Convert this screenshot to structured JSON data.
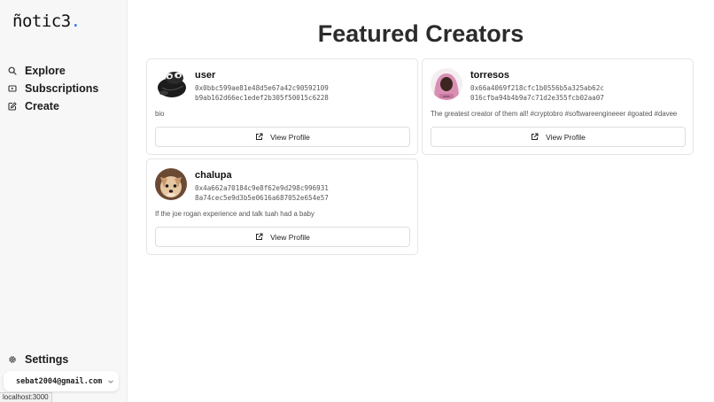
{
  "brand": {
    "name": "ñotic3",
    "dot": ".",
    "accent": "#2f6fe4"
  },
  "sidebar": {
    "items": [
      {
        "label": "Explore",
        "icon": "search-icon"
      },
      {
        "label": "Subscriptions",
        "icon": "subscriptions-icon"
      },
      {
        "label": "Create",
        "icon": "edit-icon"
      }
    ],
    "settings": {
      "label": "Settings",
      "icon": "gear-icon"
    },
    "account": {
      "email": "sebat2004@gmail.com",
      "icon": "chevron-down-icon"
    }
  },
  "status_bar": {
    "url": "localhost:3000"
  },
  "main": {
    "title": "Featured Creators",
    "creators": [
      {
        "name": "user",
        "address_line1": "0x0bbc599ae81e48d5e67a42c90592109",
        "address_line2": "b9ab162d66ec1edef2b305f50015c6228",
        "bio": "bio",
        "button_label": "View Profile",
        "avatar": "frog-avatar"
      },
      {
        "name": "torresos",
        "address_line1": "0x66a4069f218cfc1b0556b5a325ab62c",
        "address_line2": "016cfba94b4b9a7c71d2e355fcb02aa07",
        "bio": "The greatest creator of them all! #cryptobro #softwareengineeer #goated #davee",
        "button_label": "View Profile",
        "avatar": "pink-hood-avatar"
      },
      {
        "name": "chalupa",
        "address_line1": "0x4a662a70184c9e8f62e9d298c996931",
        "address_line2": "8a74cec5e9d3b5e0616a687052e654e57",
        "bio": "If the joe rogan experience and talk tuah had a baby",
        "button_label": "View Profile",
        "avatar": "dog-avatar"
      }
    ]
  }
}
